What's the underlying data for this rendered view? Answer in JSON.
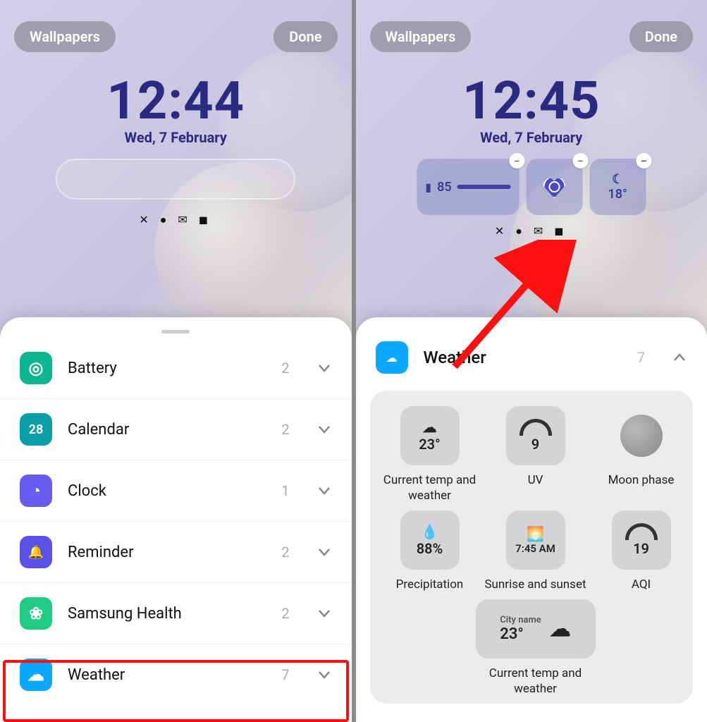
{
  "left": {
    "wallpapers_btn": "Wallpapers",
    "done_btn": "Done",
    "time": "12:44",
    "date": "Wed, 7 February",
    "categories": [
      {
        "icon": "battery",
        "label": "Battery",
        "count": "2",
        "color": "ic-battery",
        "glyph": "◎"
      },
      {
        "icon": "calendar",
        "label": "Calendar",
        "count": "2",
        "color": "ic-calendar",
        "glyph": "28"
      },
      {
        "icon": "clock",
        "label": "Clock",
        "count": "1",
        "color": "ic-clock",
        "glyph": "◔"
      },
      {
        "icon": "reminder",
        "label": "Reminder",
        "count": "2",
        "color": "ic-reminder",
        "glyph": "🔔"
      },
      {
        "icon": "health",
        "label": "Samsung Health",
        "count": "2",
        "color": "ic-health",
        "glyph": "❀"
      },
      {
        "icon": "weather",
        "label": "Weather",
        "count": "7",
        "color": "ic-weather",
        "glyph": "☁"
      }
    ],
    "highlight_index": 5
  },
  "right": {
    "wallpapers_btn": "Wallpapers",
    "done_btn": "Done",
    "time": "12:45",
    "date": "Wed, 7 February",
    "battery_widget": "85",
    "temp_widget": "18°",
    "header": {
      "label": "Weather",
      "count": "7"
    },
    "widgets": [
      {
        "value": "23°",
        "glyph": "☁",
        "caption": "Current temp and weather"
      },
      {
        "value": "9",
        "gauge": true,
        "caption": "UV"
      },
      {
        "moon": true,
        "caption": "Moon phase"
      },
      {
        "value": "88%",
        "glyph": "💧",
        "caption": "Precipitation"
      },
      {
        "value": "7:45 AM",
        "glyph": "🌅",
        "caption": "Sunrise and sunset"
      },
      {
        "value": "19",
        "gauge": true,
        "caption": "AQI"
      }
    ],
    "wide_widget": {
      "city": "City name",
      "temp": "23°",
      "caption": "Current temp and weather"
    }
  }
}
